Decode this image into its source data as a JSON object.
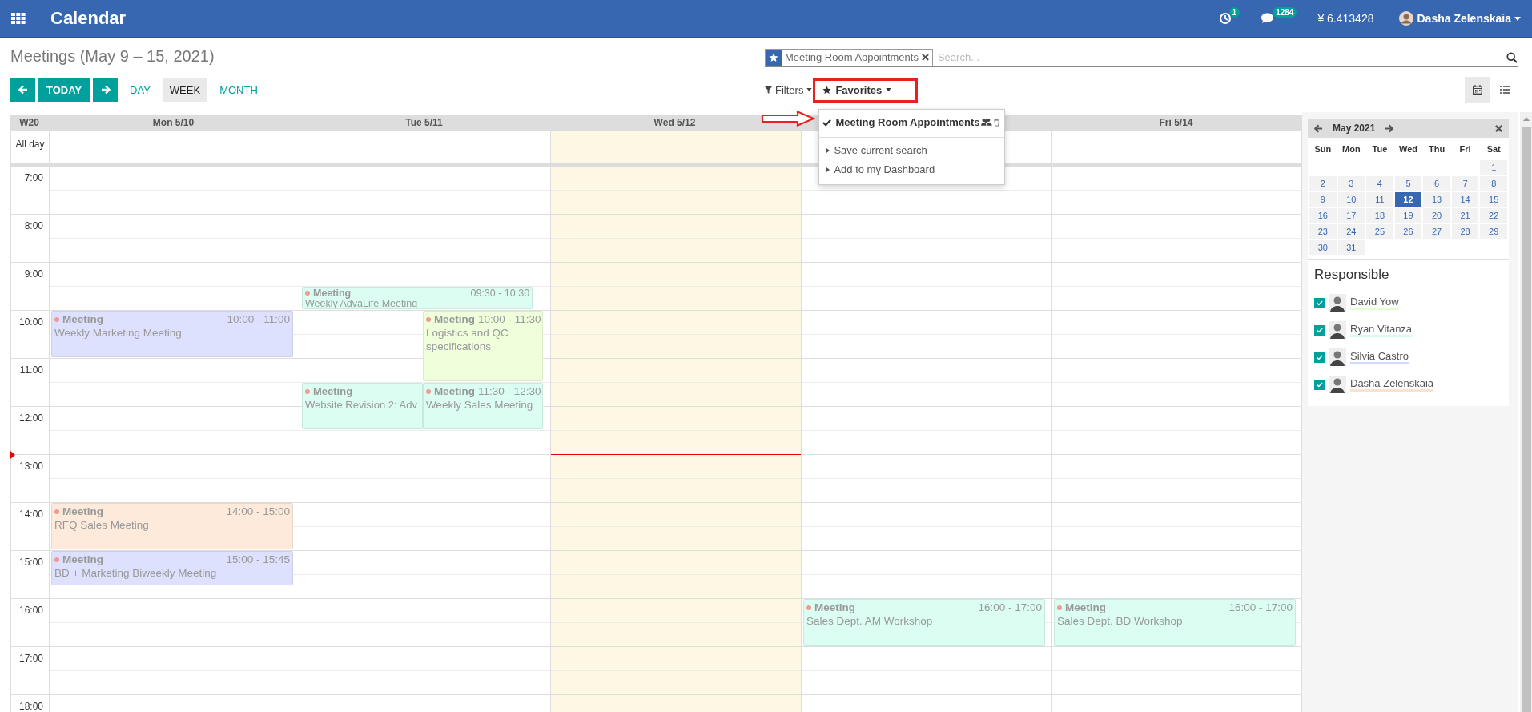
{
  "app": {
    "title": "Calendar"
  },
  "topbar": {
    "activity_count": "1",
    "message_count": "1284",
    "balance": "¥ 6.413428",
    "user": "Dasha Zelenskaia"
  },
  "page_title": "Meetings (May 9 – 15, 2021)",
  "nav": {
    "today": "TODAY"
  },
  "scales": [
    {
      "label": "DAY",
      "selected": false
    },
    {
      "label": "WEEK",
      "selected": true
    },
    {
      "label": "MONTH",
      "selected": false
    }
  ],
  "search": {
    "facet": "Meeting Room Appointments",
    "placeholder": "Search..."
  },
  "filters": {
    "label": "Filters"
  },
  "favorites": {
    "label": "Favorites",
    "expanded": true,
    "items": [
      {
        "label": "Meeting Room Appointments",
        "kind": "saved",
        "checked": true
      },
      {
        "label": "Save current search",
        "kind": "action"
      },
      {
        "label": "Add to my Dashboard",
        "kind": "action"
      }
    ]
  },
  "views": [
    {
      "kind": "calendar",
      "selected": true
    },
    {
      "kind": "list",
      "selected": false
    }
  ],
  "calendar": {
    "week": "W20",
    "all_day": "All day",
    "hours": [
      {
        "label": "7:00",
        "now": false
      },
      {
        "label": "8:00",
        "now": false
      },
      {
        "label": "9:00",
        "now": false
      },
      {
        "label": "10:00",
        "now": false
      },
      {
        "label": "11:00",
        "now": false
      },
      {
        "label": "12:00",
        "now": false
      },
      {
        "label": "13:00",
        "now": true
      },
      {
        "label": "14:00",
        "now": false
      },
      {
        "label": "15:00",
        "now": false
      },
      {
        "label": "16:00",
        "now": false
      },
      {
        "label": "17:00",
        "now": false
      },
      {
        "label": "18:00",
        "now": false
      }
    ],
    "days": [
      {
        "label": "Mon 5/10",
        "today": false,
        "events": [
          {
            "category": "Meeting",
            "time": "10:00 - 11:00",
            "title": "Weekly Marketing Meeting",
            "color": "#dde1fd"
          },
          {
            "category": "Meeting",
            "time": "14:00 - 15:00",
            "title": "RFQ Sales Meeting",
            "color": "#fdeadb"
          },
          {
            "category": "Meeting",
            "time": "15:00 - 15:45",
            "title": "BD + Marketing Biweekly Meeting",
            "color": "#dde1fd"
          }
        ]
      },
      {
        "label": "Tue 5/11",
        "today": false,
        "events": [
          {
            "category": "Meeting",
            "time": "09:30 - 10:30",
            "title": "Weekly AdvaLife Meeting",
            "color": "#dcfdf1"
          },
          {
            "category": "Meeting",
            "time": "10:00 - 11:30",
            "title": "Logistics and QC specifications",
            "color": "#effedb"
          },
          {
            "category": "Meeting",
            "title": "Website Revision 2: Adv",
            "color": "#dcfdf1"
          },
          {
            "category": "Meeting",
            "time": "11:30 - 12:30",
            "title": "Weekly Sales Meeting",
            "color": "#dcfdf1"
          }
        ]
      },
      {
        "label": "Wed 5/12",
        "today": true
      },
      {
        "today": false,
        "events": [
          {
            "category": "Meeting",
            "time": "16:00 - 17:00",
            "title": "Sales Dept. AM Workshop",
            "color": "#dcfdf1"
          }
        ]
      },
      {
        "label": "Fri 5/14",
        "today": false,
        "events": [
          {
            "category": "Meeting",
            "time": "16:00 - 17:00",
            "title": "Sales Dept. BD Workshop",
            "color": "#dcfdf1"
          }
        ]
      }
    ]
  },
  "mini_calendar": {
    "title": "May 2021",
    "weekdays": [
      "Sun",
      "Mon",
      "Tue",
      "Wed",
      "Thu",
      "Fri",
      "Sat"
    ],
    "weeks": [
      [
        {
          "label": "1",
          "selected": false
        }
      ],
      [
        {
          "label": "2",
          "selected": false
        },
        {
          "label": "3",
          "selected": false
        },
        {
          "label": "4",
          "selected": false
        },
        {
          "label": "5",
          "selected": false
        },
        {
          "label": "6",
          "selected": false
        },
        {
          "label": "7",
          "selected": false
        },
        {
          "label": "8",
          "selected": false
        }
      ],
      [
        {
          "label": "9",
          "selected": false
        },
        {
          "label": "10",
          "selected": false
        },
        {
          "label": "11",
          "selected": false
        },
        {
          "label": "12",
          "selected": true
        },
        {
          "label": "13",
          "selected": false
        },
        {
          "label": "14",
          "selected": false
        },
        {
          "label": "15",
          "selected": false
        }
      ],
      [
        {
          "label": "16",
          "selected": false
        },
        {
          "label": "17",
          "selected": false
        },
        {
          "label": "18",
          "selected": false
        },
        {
          "label": "19",
          "selected": false
        },
        {
          "label": "20",
          "selected": false
        },
        {
          "label": "21",
          "selected": false
        },
        {
          "label": "22",
          "selected": false
        }
      ],
      [
        {
          "label": "23",
          "selected": false
        },
        {
          "label": "24",
          "selected": false
        },
        {
          "label": "25",
          "selected": false
        },
        {
          "label": "26",
          "selected": false
        },
        {
          "label": "27",
          "selected": false
        },
        {
          "label": "28",
          "selected": false
        },
        {
          "label": "29",
          "selected": false
        }
      ],
      [
        {
          "label": "30",
          "selected": false
        },
        {
          "label": "31",
          "selected": false
        }
      ]
    ]
  },
  "responsible": {
    "title": "Responsible",
    "people": [
      {
        "name": "David Yow",
        "checked": true,
        "color": "#e6fdd4"
      },
      {
        "name": "Ryan Vitanza",
        "checked": true,
        "color": "#d6fbef"
      },
      {
        "name": "Silvia Castro",
        "checked": true,
        "color": "#d3d8fd"
      },
      {
        "name": "Dasha Zelenskaia",
        "checked": true,
        "color": "#fde2cc"
      }
    ]
  }
}
